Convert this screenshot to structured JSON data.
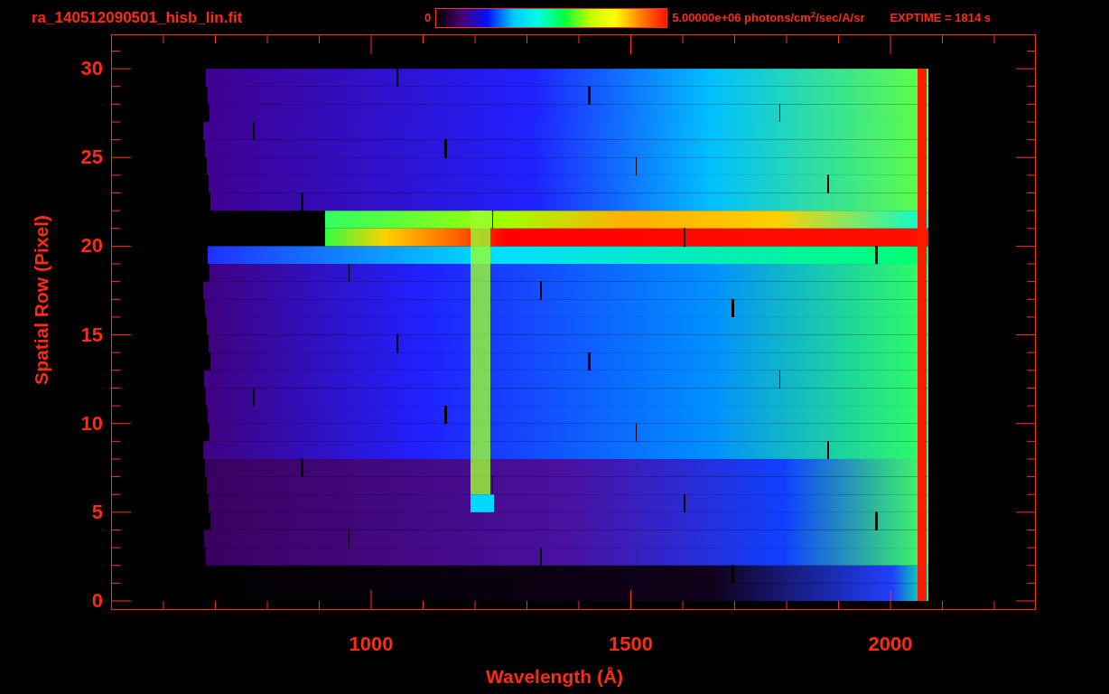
{
  "title": "ra_140512090501_hisb_lin.fit",
  "colorbar": {
    "min_label": "0",
    "max_label": "5.00000e+06 photons/cm$^{2}$/sec/A/sr"
  },
  "exposure": "EXPTIME = 1814 s",
  "y_axis": {
    "label": "Spatial Row (Pixel)",
    "ticks": [
      "30",
      "25",
      "20",
      "15",
      "10",
      "5",
      "0"
    ]
  },
  "x_axis": {
    "label": "Wavelength (Å)",
    "ticks": [
      "1000",
      "1500",
      "2000"
    ]
  }
}
